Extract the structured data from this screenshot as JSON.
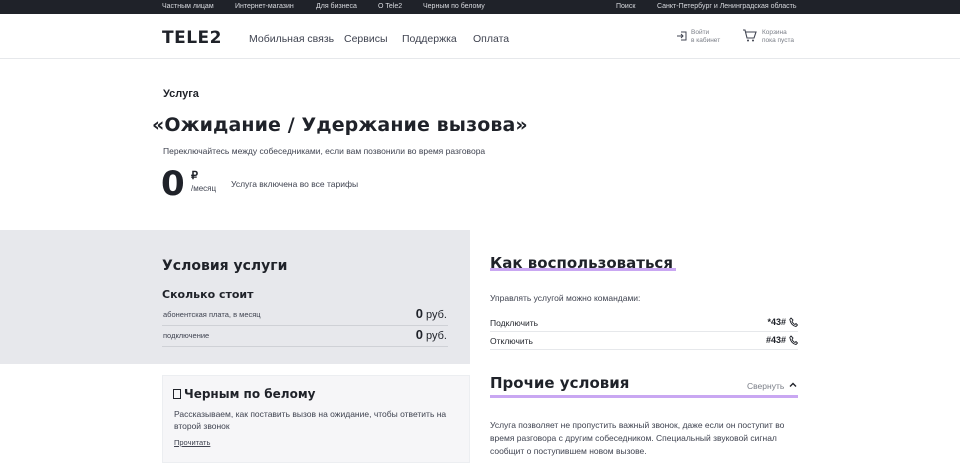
{
  "topbar": {
    "links": [
      "Частным лицам",
      "Интернет-магазин",
      "Для бизнеса",
      "О Tele2",
      "Черным по белому"
    ],
    "search": "Поиск",
    "region": "Санкт-Петербург и Ленинградская область"
  },
  "header": {
    "logo": "TELE2",
    "nav": [
      "Мобильная связь",
      "Сервисы",
      "Поддержка",
      "Оплата"
    ],
    "login_line1": "Войти",
    "login_line2": "в кабинет",
    "cart_line1": "Корзина",
    "cart_line2": "пока пуста"
  },
  "hero": {
    "eyebrow": "Услуга",
    "title": "«Ожидание / Удержание вызова»",
    "subtitle": "Переключайтесь между собеседниками, если вам позвонили во время разговора",
    "price": "0",
    "currency": "₽",
    "period": "/месяц",
    "note": "Услуга включена во все тарифы"
  },
  "conditions": {
    "title": "Условия услуги",
    "cost_title": "Сколько стоит",
    "rows": [
      {
        "label": "абонентская плата, в месяц",
        "value": "0",
        "unit": "руб."
      },
      {
        "label": "подключение",
        "value": "0",
        "unit": "руб."
      }
    ]
  },
  "article": {
    "title": "Черным по белому",
    "text": "Рассказываем, как поставить вызов на ожидание, чтобы ответить на второй звонок",
    "link": "Прочитать"
  },
  "how": {
    "title": "Как воспользоваться",
    "intro": "Управлять услугой можно командами:",
    "commands": [
      {
        "label": "Подключить",
        "code": "*43#"
      },
      {
        "label": "Отключить",
        "code": "#43#"
      }
    ]
  },
  "other": {
    "title": "Прочие условия",
    "collapse": "Свернуть",
    "text": "Услуга позволяет не пропустить важный звонок, даже если он поступит во время разговора с другим собеседником. Специальный звуковой сигнал сообщит о поступившем новом вызове."
  },
  "colors": {
    "topbar_bg": "#1f2229",
    "panel_bg": "#e7e8ec",
    "accent_underline": "#c9a7f2"
  }
}
